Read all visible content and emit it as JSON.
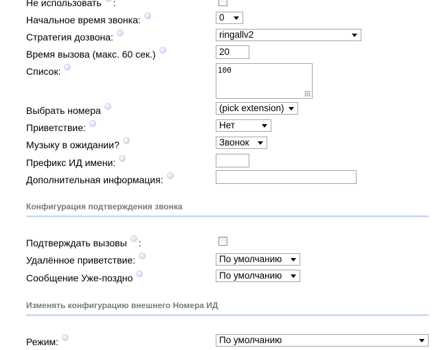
{
  "form": {
    "not_use": {
      "label": "Не использовать",
      "colon": ":",
      "checked": false
    },
    "start_time": {
      "label": "Начальное время звонка:",
      "value": "0"
    },
    "strategy": {
      "label": "Стратегия дозвона:",
      "value": "ringallv2"
    },
    "call_time": {
      "label": "Время вызова (макс. 60 сек.)",
      "value": "20"
    },
    "list": {
      "label": "Список:",
      "value": "100"
    },
    "pick_numbers": {
      "label": "Выбрать номера",
      "value": "(pick extension)"
    },
    "greeting": {
      "label": "Приветствие:",
      "value": "Нет"
    },
    "moh": {
      "label": "Музыку в ожидании?",
      "value": "Звонок"
    },
    "cid_prefix": {
      "label": "Префикс ИД имени:",
      "value": ""
    },
    "extra_info": {
      "label": "Дополнительная информация:",
      "value": ""
    }
  },
  "confirm_section": {
    "title": "Конфигурация подтверждения звонка",
    "confirm_calls": {
      "label": "Подтверждать вызовы",
      "colon": ":",
      "checked": false
    },
    "remote_greeting": {
      "label": "Удалённое приветствие:",
      "value": "По умолчанию"
    },
    "too_late": {
      "label": "Сообщение Уже-поздно",
      "value": "По умолчанию"
    }
  },
  "cid_section": {
    "title": "Изменять конфигурацию внешнего Номера ИД",
    "mode": {
      "label": "Режим:",
      "value": "По умолчанию"
    }
  },
  "icons": {
    "help": "help-bubble-icon",
    "dropdown": "chevron-down-icon",
    "resize": "resize-grip-icon"
  },
  "colors": {
    "section_title": "#7a7a7a",
    "section_rule": "#c7d7ea",
    "help_bubble": "#b7c8e2"
  }
}
